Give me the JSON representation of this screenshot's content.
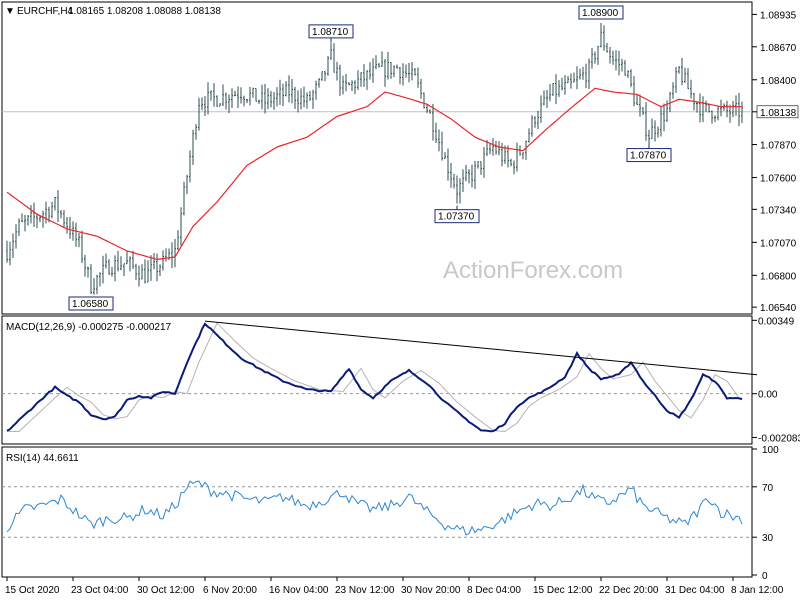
{
  "header": {
    "arrow": "▼",
    "title": "EURCHF,H4",
    "ohlc": "1.08165 1.08208 1.08088 1.08138"
  },
  "watermark": "ActionForex.com",
  "colors": {
    "candles": "#2f4f4f",
    "ma": "#e8262b",
    "macd": "#0b1a78",
    "signal": "#b4b4b4",
    "rsi": "#2e86d1",
    "trendline": "#000000",
    "last_price_bg": "#ffffff"
  },
  "chart_data": [
    {
      "type": "candlestick",
      "name": "price",
      "ylim": [
        1.065,
        1.0902
      ],
      "y_ticks": [
        "1.08935",
        "1.08670",
        "1.08400",
        "1.08138",
        "1.07870",
        "1.07600",
        "1.07340",
        "1.07070",
        "1.06800",
        "1.06540"
      ],
      "last_price": "1.08138",
      "ma_overlay": "moving average",
      "annotations": [
        {
          "label": "1.06580",
          "bar": 28,
          "value": 1.0658,
          "side": "below"
        },
        {
          "label": "1.08710",
          "bar": 108,
          "value": 1.0871,
          "side": "above"
        },
        {
          "label": "1.07370",
          "bar": 150,
          "value": 1.0737,
          "side": "below"
        },
        {
          "label": "1.08900",
          "bar": 198,
          "value": 1.089,
          "side": "above"
        },
        {
          "label": "1.07870",
          "bar": 214,
          "value": 1.0787,
          "side": "below"
        }
      ],
      "close_anchors": [
        [
          0,
          1.07
        ],
        [
          4,
          1.072
        ],
        [
          10,
          1.0728
        ],
        [
          16,
          1.0738
        ],
        [
          20,
          1.0722
        ],
        [
          24,
          1.0705
        ],
        [
          28,
          1.0672
        ],
        [
          34,
          1.0688
        ],
        [
          40,
          1.069
        ],
        [
          46,
          1.068
        ],
        [
          52,
          1.069
        ],
        [
          56,
          1.07
        ],
        [
          64,
          1.0823
        ],
        [
          70,
          1.0825
        ],
        [
          78,
          1.083
        ],
        [
          86,
          1.0822
        ],
        [
          94,
          1.083
        ],
        [
          100,
          1.0822
        ],
        [
          104,
          1.0835
        ],
        [
          108,
          1.0858
        ],
        [
          112,
          1.0832
        ],
        [
          118,
          1.084
        ],
        [
          124,
          1.0848
        ],
        [
          130,
          1.085
        ],
        [
          136,
          1.084
        ],
        [
          142,
          1.0805
        ],
        [
          146,
          1.0775
        ],
        [
          150,
          1.075
        ],
        [
          156,
          1.0765
        ],
        [
          162,
          1.0785
        ],
        [
          168,
          1.077
        ],
        [
          172,
          1.0785
        ],
        [
          176,
          1.081
        ],
        [
          182,
          1.083
        ],
        [
          188,
          1.0835
        ],
        [
          194,
          1.0848
        ],
        [
          198,
          1.0875
        ],
        [
          202,
          1.0856
        ],
        [
          206,
          1.085
        ],
        [
          210,
          1.0818
        ],
        [
          214,
          1.0795
        ],
        [
          220,
          1.0815
        ],
        [
          224,
          1.0848
        ],
        [
          228,
          1.0828
        ],
        [
          232,
          1.0815
        ],
        [
          238,
          1.0814
        ]
      ],
      "ma_anchors": [
        [
          0,
          1.0748
        ],
        [
          10,
          1.073
        ],
        [
          20,
          1.0718
        ],
        [
          30,
          1.0712
        ],
        [
          40,
          1.07
        ],
        [
          50,
          1.0693
        ],
        [
          56,
          1.0695
        ],
        [
          62,
          1.072
        ],
        [
          70,
          1.074
        ],
        [
          80,
          1.077
        ],
        [
          90,
          1.0785
        ],
        [
          100,
          1.0793
        ],
        [
          110,
          1.081
        ],
        [
          120,
          1.0818
        ],
        [
          126,
          1.083
        ],
        [
          132,
          1.0826
        ],
        [
          140,
          1.082
        ],
        [
          148,
          1.0808
        ],
        [
          156,
          1.0793
        ],
        [
          164,
          1.0785
        ],
        [
          172,
          1.0782
        ],
        [
          180,
          1.08
        ],
        [
          188,
          1.0817
        ],
        [
          196,
          1.0833
        ],
        [
          202,
          1.083
        ],
        [
          210,
          1.0828
        ],
        [
          218,
          1.0818
        ],
        [
          224,
          1.0824
        ],
        [
          230,
          1.0822
        ],
        [
          238,
          1.0818
        ]
      ]
    },
    {
      "type": "line",
      "name": "MACD(12,26,9) -0.000275 -0.000217",
      "label": "MACD(12,26,9) -0.000275 -0.000217",
      "ylim": [
        -0.0023,
        0.0036
      ],
      "y_ticks": [
        "0.00349",
        "0.00",
        "-0.002083"
      ],
      "zero_level": 0.0,
      "macd_anchors": [
        [
          0,
          -0.0018
        ],
        [
          6,
          -0.001
        ],
        [
          12,
          -0.0002
        ],
        [
          16,
          0.0003
        ],
        [
          20,
          -0.0001
        ],
        [
          24,
          -0.0004
        ],
        [
          28,
          -0.001
        ],
        [
          32,
          -0.0012
        ],
        [
          36,
          -0.0011
        ],
        [
          40,
          -0.0003
        ],
        [
          44,
          -0.0001
        ],
        [
          48,
          -0.0002
        ],
        [
          52,
          0.0001
        ],
        [
          56,
          0.0
        ],
        [
          60,
          0.0015
        ],
        [
          66,
          0.00335
        ],
        [
          72,
          0.0025
        ],
        [
          78,
          0.0017
        ],
        [
          84,
          0.0012
        ],
        [
          92,
          0.0006
        ],
        [
          100,
          0.0002
        ],
        [
          108,
          0.0001
        ],
        [
          114,
          0.0012
        ],
        [
          118,
          0.0002
        ],
        [
          122,
          -0.0002
        ],
        [
          128,
          0.0006
        ],
        [
          134,
          0.0011
        ],
        [
          140,
          0.0005
        ],
        [
          146,
          -0.0004
        ],
        [
          152,
          -0.0011
        ],
        [
          158,
          -0.00175
        ],
        [
          162,
          -0.0018
        ],
        [
          166,
          -0.0014
        ],
        [
          170,
          -0.0006
        ],
        [
          174,
          -0.0002
        ],
        [
          180,
          0.0002
        ],
        [
          186,
          0.0008
        ],
        [
          190,
          0.0019
        ],
        [
          194,
          0.0012
        ],
        [
          198,
          0.0007
        ],
        [
          204,
          0.0009
        ],
        [
          208,
          0.0015
        ],
        [
          212,
          0.0006
        ],
        [
          216,
          -0.0001
        ],
        [
          220,
          -0.0008
        ],
        [
          224,
          -0.00115
        ],
        [
          228,
          -0.0003
        ],
        [
          232,
          0.0009
        ],
        [
          236,
          0.0006
        ],
        [
          240,
          -0.0002
        ],
        [
          248,
          -0.00027
        ]
      ],
      "trendline": [
        [
          66,
          0.00345
        ],
        [
          250,
          0.0009
        ]
      ]
    },
    {
      "type": "line",
      "name": "RSI(14) 44.6611",
      "label": "RSI(14) 44.6611",
      "ylim": [
        0,
        100
      ],
      "y_ticks": [
        "100",
        "70",
        "30",
        "0"
      ],
      "levels": [
        70,
        30
      ],
      "rsi_anchors": [
        [
          0,
          38
        ],
        [
          6,
          52
        ],
        [
          12,
          55
        ],
        [
          18,
          60
        ],
        [
          24,
          48
        ],
        [
          28,
          40
        ],
        [
          34,
          45
        ],
        [
          40,
          45
        ],
        [
          46,
          52
        ],
        [
          52,
          47
        ],
        [
          56,
          55
        ],
        [
          60,
          70
        ],
        [
          64,
          73
        ],
        [
          68,
          67
        ],
        [
          74,
          64
        ],
        [
          80,
          60
        ],
        [
          86,
          58
        ],
        [
          92,
          62
        ],
        [
          100,
          55
        ],
        [
          106,
          60
        ],
        [
          112,
          66
        ],
        [
          116,
          57
        ],
        [
          122,
          52
        ],
        [
          128,
          55
        ],
        [
          134,
          62
        ],
        [
          140,
          50
        ],
        [
          146,
          40
        ],
        [
          152,
          35
        ],
        [
          158,
          36
        ],
        [
          164,
          42
        ],
        [
          170,
          50
        ],
        [
          176,
          57
        ],
        [
          182,
          55
        ],
        [
          188,
          62
        ],
        [
          192,
          67
        ],
        [
          196,
          60
        ],
        [
          200,
          57
        ],
        [
          204,
          62
        ],
        [
          208,
          68
        ],
        [
          212,
          55
        ],
        [
          216,
          50
        ],
        [
          220,
          45
        ],
        [
          226,
          40
        ],
        [
          230,
          50
        ],
        [
          234,
          62
        ],
        [
          238,
          50
        ],
        [
          244,
          45
        ],
        [
          248,
          44.6611
        ]
      ],
      "last_value": 44.6611
    }
  ],
  "x_axis": {
    "labels": [
      "15 Oct 2020",
      "23 Oct 04:00",
      "30 Oct 12:00",
      "6 Nov 20:00",
      "16 Nov 04:00",
      "23 Nov 12:00",
      "30 Nov 20:00",
      "8 Dec 04:00",
      "15 Dec 12:00",
      "22 Dec 20:00",
      "31 Dec 04:00",
      "8 Jan 12:00"
    ],
    "label_bars": [
      0,
      22,
      44,
      66,
      88,
      110,
      132,
      154,
      176,
      198,
      220,
      242
    ]
  }
}
